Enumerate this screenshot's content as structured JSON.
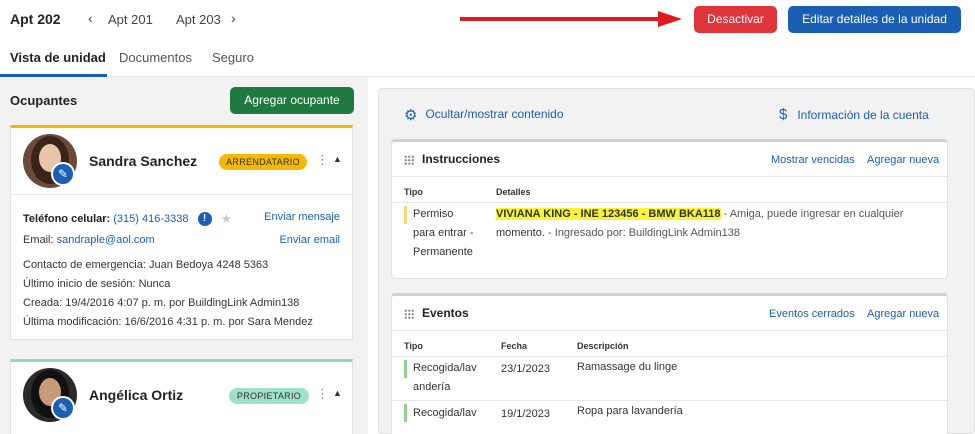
{
  "header": {
    "apt_current": "Apt 202",
    "prev_apt": "Apt 201",
    "next_apt": "Apt 203",
    "deactivate_label": "Desactivar",
    "edit_label": "Editar detalles de la unidad"
  },
  "tabs": [
    {
      "label": "Vista de unidad",
      "active": true
    },
    {
      "label": "Documentos",
      "active": false
    },
    {
      "label": "Seguro",
      "active": false
    }
  ],
  "occupants": {
    "title": "Ocupantes",
    "add_label": "Agregar ocupante",
    "list": [
      {
        "name": "Sandra Sanchez",
        "role": "ARRENDATARIO",
        "role_color": "#f5b800",
        "phone_label": "Teléfono celular:",
        "phone": "(315) 416-3338",
        "send_message": "Enviar mensaje",
        "email_label": "Email:",
        "email": "sandraple@aol.com",
        "send_email": "Enviar email",
        "emergency_label": "Contacto de emergencia:",
        "emergency": "Juan Bedoya 4248 5363",
        "last_login_label": "Último inicio de sesión:",
        "last_login": "Nunca",
        "created_label": "Creada:",
        "created": "19/4/2016 4:07 p. m. por BuildingLink Admin138",
        "modified_label": "Última modificación:",
        "modified": "16/6/2016 4:31 p. m. por Sara Mendez"
      },
      {
        "name": "Angélica Ortiz",
        "role": "PROPIETARIO",
        "role_color": "#9fe0c8"
      }
    ]
  },
  "right": {
    "toggle_label": "Ocultar/mostrar contenido",
    "account_label": "Información de la cuenta",
    "instructions": {
      "title": "Instrucciones",
      "show_expired": "Mostrar vencidas",
      "add_new": "Agregar nueva",
      "col_type": "Tipo",
      "col_details": "Detalles",
      "rows": [
        {
          "type_l1": "Permiso",
          "type_l2": "para entrar -",
          "type_l3": "Permanente",
          "highlight": "VIVIANA KING - INE 123456 - BMW BKA118",
          "detail_rest": " - Amiga, puede ingresar en cualquier",
          "detail_l2a": "momento.",
          "detail_l2b": " - Ingresado por: BuildingLink Admin138",
          "bar_color": "#f5d76e"
        }
      ]
    },
    "events": {
      "title": "Eventos",
      "closed": "Eventos cerrados",
      "add_new": "Agregar nueva",
      "col_type": "Tipo",
      "col_date": "Fecha",
      "col_desc": "Descripción",
      "rows": [
        {
          "type_l1": "Recogida/lav",
          "type_l2": "andería",
          "date": "23/1/2023",
          "desc": "Ramassage du linge",
          "bar_color": "#8fcf8f"
        },
        {
          "type_l1": "Recogida/lav",
          "type_l2": "",
          "date": "19/1/2023",
          "desc": "Ropa para lavandería",
          "bar_color": "#8fcf8f"
        }
      ]
    }
  }
}
